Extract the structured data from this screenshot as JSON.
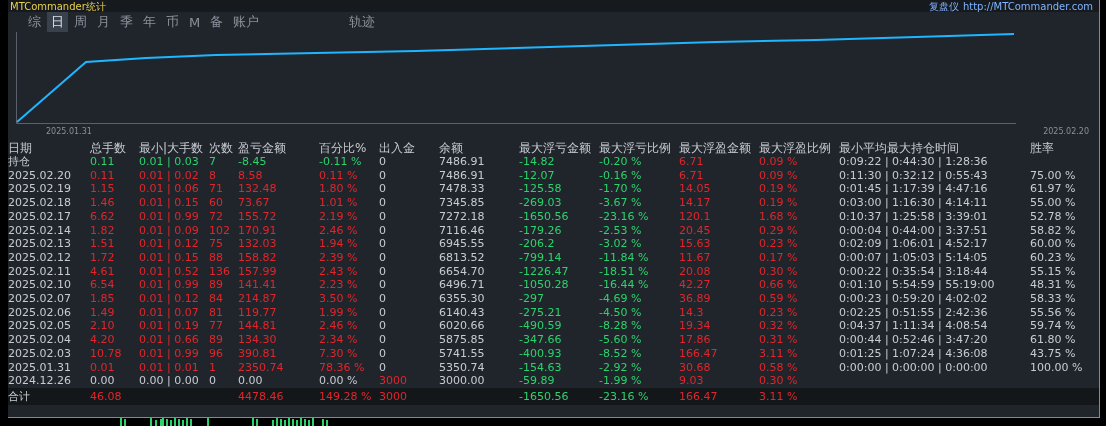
{
  "window": {
    "title": "MTCommander统计",
    "brand": "复盘仪",
    "url": "http://MTCommander.com"
  },
  "tabs": [
    {
      "label": "综",
      "selected": false
    },
    {
      "label": "日",
      "selected": true
    },
    {
      "label": "周",
      "selected": false
    },
    {
      "label": "月",
      "selected": false
    },
    {
      "label": "季",
      "selected": false
    },
    {
      "label": "年",
      "selected": false
    },
    {
      "label": "币",
      "selected": false
    },
    {
      "label": "M",
      "selected": false
    },
    {
      "label": "备",
      "selected": false
    },
    {
      "label": "账户",
      "selected": false
    },
    {
      "label": "轨迹",
      "selected": false
    }
  ],
  "chart": {
    "start_label": "2025.01.31",
    "end_label": "2025.02.20"
  },
  "table": {
    "columns": [
      "日期",
      "总手数",
      "最小|大手数",
      "次数",
      "盈亏金额",
      "百分比%",
      "出入金",
      "余额",
      "最大浮亏金额",
      "最大浮亏比例",
      "最大浮盈金额",
      "最大浮盈比例",
      "最小平均最大持仓时间",
      "胜率"
    ],
    "rows": [
      {
        "kind": "position",
        "date": "持仓",
        "total_lots": "0.11",
        "min_max_lots": "0.01 | 0.03",
        "count": "7",
        "pnl": "-8.45",
        "percent": "-0.11 %",
        "deposit": "0",
        "balance": "7486.91",
        "max_float_loss": "-14.82",
        "max_float_loss_pct": "-0.20 %",
        "max_float_profit": "6.71",
        "max_float_profit_pct": "0.09 %",
        "hold_time": "0:09:22 | 0:44:30 | 1:28:36"
      },
      {
        "kind": "day",
        "date": "2025.02.20",
        "total_lots": "0.11",
        "min_max_lots": "0.01 | 0.02",
        "count": "8",
        "pnl": "8.58",
        "percent": "0.11 %",
        "deposit": "0",
        "balance": "7486.91",
        "max_float_loss": "-12.07",
        "max_float_loss_pct": "-0.16 %",
        "max_float_profit": "6.71",
        "max_float_profit_pct": "0.09 %",
        "hold_time": "0:11:30 | 0:32:12 | 0:55:43",
        "win_rate": "75.00 %"
      },
      {
        "kind": "day",
        "date": "2025.02.19",
        "total_lots": "1.15",
        "min_max_lots": "0.01 | 0.06",
        "count": "71",
        "pnl": "132.48",
        "percent": "1.80 %",
        "deposit": "0",
        "balance": "7478.33",
        "max_float_loss": "-125.58",
        "max_float_loss_pct": "-1.70 %",
        "max_float_profit": "14.05",
        "max_float_profit_pct": "0.19 %",
        "hold_time": "0:01:45 | 1:17:39 | 4:47:16",
        "win_rate": "61.97 %"
      },
      {
        "kind": "day",
        "date": "2025.02.18",
        "total_lots": "1.46",
        "min_max_lots": "0.01 | 0.15",
        "count": "60",
        "pnl": "73.67",
        "percent": "1.01 %",
        "deposit": "0",
        "balance": "7345.85",
        "max_float_loss": "-269.03",
        "max_float_loss_pct": "-3.67 %",
        "max_float_profit": "14.17",
        "max_float_profit_pct": "0.19 %",
        "hold_time": "0:03:00 | 1:16:30 | 4:14:11",
        "win_rate": "55.00 %"
      },
      {
        "kind": "day",
        "date": "2025.02.17",
        "total_lots": "6.62",
        "min_max_lots": "0.01 | 0.99",
        "count": "72",
        "pnl": "155.72",
        "percent": "2.19 %",
        "deposit": "0",
        "balance": "7272.18",
        "max_float_loss": "-1650.56",
        "max_float_loss_pct": "-23.16 %",
        "max_float_profit": "120.1",
        "max_float_profit_pct": "1.68 %",
        "hold_time": "0:10:37 | 1:25:58 | 3:39:01",
        "win_rate": "52.78 %"
      },
      {
        "kind": "day",
        "date": "2025.02.14",
        "total_lots": "1.82",
        "min_max_lots": "0.01 | 0.09",
        "count": "102",
        "pnl": "170.91",
        "percent": "2.46 %",
        "deposit": "0",
        "balance": "7116.46",
        "max_float_loss": "-179.26",
        "max_float_loss_pct": "-2.53 %",
        "max_float_profit": "20.45",
        "max_float_profit_pct": "0.29 %",
        "hold_time": "0:00:04 | 0:44:00 | 3:37:51",
        "win_rate": "58.82 %"
      },
      {
        "kind": "day",
        "date": "2025.02.13",
        "total_lots": "1.51",
        "min_max_lots": "0.01 | 0.12",
        "count": "75",
        "pnl": "132.03",
        "percent": "1.94 %",
        "deposit": "0",
        "balance": "6945.55",
        "max_float_loss": "-206.2",
        "max_float_loss_pct": "-3.02 %",
        "max_float_profit": "15.63",
        "max_float_profit_pct": "0.23 %",
        "hold_time": "0:02:09 | 1:06:01 | 4:52:17",
        "win_rate": "60.00 %"
      },
      {
        "kind": "day",
        "date": "2025.02.12",
        "total_lots": "1.72",
        "min_max_lots": "0.01 | 0.15",
        "count": "88",
        "pnl": "158.82",
        "percent": "2.39 %",
        "deposit": "0",
        "balance": "6813.52",
        "max_float_loss": "-799.14",
        "max_float_loss_pct": "-11.84 %",
        "max_float_profit": "11.67",
        "max_float_profit_pct": "0.17 %",
        "hold_time": "0:00:07 | 1:05:03 | 5:14:05",
        "win_rate": "60.23 %"
      },
      {
        "kind": "day",
        "date": "2025.02.11",
        "total_lots": "4.61",
        "min_max_lots": "0.01 | 0.52",
        "count": "136",
        "pnl": "157.99",
        "percent": "2.43 %",
        "deposit": "0",
        "balance": "6654.70",
        "max_float_loss": "-1226.47",
        "max_float_loss_pct": "-18.51 %",
        "max_float_profit": "20.08",
        "max_float_profit_pct": "0.30 %",
        "hold_time": "0:00:22 | 0:35:54 | 3:18:44",
        "win_rate": "55.15 %"
      },
      {
        "kind": "day",
        "date": "2025.02.10",
        "total_lots": "6.54",
        "min_max_lots": "0.01 | 0.99",
        "count": "89",
        "pnl": "141.41",
        "percent": "2.23 %",
        "deposit": "0",
        "balance": "6496.71",
        "max_float_loss": "-1050.28",
        "max_float_loss_pct": "-16.44 %",
        "max_float_profit": "42.27",
        "max_float_profit_pct": "0.66 %",
        "hold_time": "0:01:10 | 5:54:59 | 55:19:00",
        "win_rate": "48.31 %"
      },
      {
        "kind": "day",
        "date": "2025.02.07",
        "total_lots": "1.85",
        "min_max_lots": "0.01 | 0.12",
        "count": "84",
        "pnl": "214.87",
        "percent": "3.50 %",
        "deposit": "0",
        "balance": "6355.30",
        "max_float_loss": "-297",
        "max_float_loss_pct": "-4.69 %",
        "max_float_profit": "36.89",
        "max_float_profit_pct": "0.59 %",
        "hold_time": "0:00:23 | 0:59:20 | 4:02:02",
        "win_rate": "58.33 %"
      },
      {
        "kind": "day",
        "date": "2025.02.06",
        "total_lots": "1.49",
        "min_max_lots": "0.01 | 0.07",
        "count": "81",
        "pnl": "119.77",
        "percent": "1.99 %",
        "deposit": "0",
        "balance": "6140.43",
        "max_float_loss": "-275.21",
        "max_float_loss_pct": "-4.50 %",
        "max_float_profit": "14.3",
        "max_float_profit_pct": "0.23 %",
        "hold_time": "0:02:25 | 0:51:55 | 2:42:36",
        "win_rate": "55.56 %"
      },
      {
        "kind": "day",
        "date": "2025.02.05",
        "total_lots": "2.10",
        "min_max_lots": "0.01 | 0.19",
        "count": "77",
        "pnl": "144.81",
        "percent": "2.46 %",
        "deposit": "0",
        "balance": "6020.66",
        "max_float_loss": "-490.59",
        "max_float_loss_pct": "-8.28 %",
        "max_float_profit": "19.34",
        "max_float_profit_pct": "0.32 %",
        "hold_time": "0:04:37 | 1:11:34 | 4:08:54",
        "win_rate": "59.74 %"
      },
      {
        "kind": "day",
        "date": "2025.02.04",
        "total_lots": "4.20",
        "min_max_lots": "0.01 | 0.66",
        "count": "89",
        "pnl": "134.30",
        "percent": "2.34 %",
        "deposit": "0",
        "balance": "5875.85",
        "max_float_loss": "-347.66",
        "max_float_loss_pct": "-5.60 %",
        "max_float_profit": "17.86",
        "max_float_profit_pct": "0.31 %",
        "hold_time": "0:00:44 | 0:52:46 | 3:47:20",
        "win_rate": "61.80 %"
      },
      {
        "kind": "day",
        "date": "2025.02.03",
        "total_lots": "10.78",
        "min_max_lots": "0.01 | 0.99",
        "count": "96",
        "pnl": "390.81",
        "percent": "7.30 %",
        "deposit": "0",
        "balance": "5741.55",
        "max_float_loss": "-400.93",
        "max_float_loss_pct": "-8.52 %",
        "max_float_profit": "166.47",
        "max_float_profit_pct": "3.11 %",
        "hold_time": "0:01:25 | 1:07:24 | 4:36:08",
        "win_rate": "43.75 %"
      },
      {
        "kind": "day",
        "date": "2025.01.31",
        "total_lots": "0.01",
        "min_max_lots": "0.01 | 0.01",
        "count": "1",
        "pnl": "2350.74",
        "percent": "78.36 %",
        "deposit": "0",
        "balance": "5350.74",
        "max_float_loss": "-154.63",
        "max_float_loss_pct": "-2.92 %",
        "max_float_profit": "30.68",
        "max_float_profit_pct": "0.58 %",
        "hold_time": "0:00:00 | 0:00:00 | 0:00:00",
        "win_rate": "100.00 %"
      },
      {
        "kind": "deposit",
        "date": "2024.12.26",
        "total_lots": "0.00",
        "min_max_lots": "0.00 | 0.00",
        "count": "0",
        "pnl": "0.00",
        "percent": "0.00 %",
        "deposit": "3000",
        "balance": "3000.00",
        "max_float_loss": "-59.89",
        "max_float_loss_pct": "-1.99 %",
        "max_float_profit": "9.03",
        "max_float_profit_pct": "0.30 %"
      },
      {
        "kind": "total",
        "date": "合计",
        "total_lots": "46.08",
        "pnl": "4478.46",
        "percent": "149.28 %",
        "deposit": "3000",
        "max_float_loss": "-1650.56",
        "max_float_loss_pct": "-23.16 %",
        "max_float_profit": "166.47",
        "max_float_profit_pct": "3.11 %"
      }
    ]
  }
}
